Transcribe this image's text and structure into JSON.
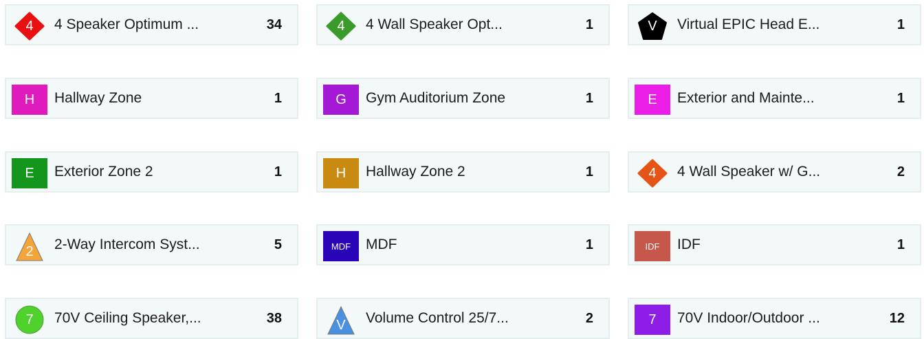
{
  "items": [
    {
      "label": "4 Speaker Optimum ...",
      "count": "34",
      "icon": {
        "name": "diamond-icon",
        "shape": "diamond",
        "color": "#e81010",
        "glyph": "4"
      }
    },
    {
      "label": "4 Wall Speaker Opt...",
      "count": "1",
      "icon": {
        "name": "diamond-icon",
        "shape": "diamond",
        "color": "#3b9b2a",
        "glyph": "4"
      }
    },
    {
      "label": "Virtual EPIC Head E...",
      "count": "1",
      "icon": {
        "name": "pentagon-icon",
        "shape": "pentagon",
        "color": "#000000",
        "glyph": "V"
      }
    },
    {
      "label": "Hallway Zone",
      "count": "1",
      "icon": {
        "name": "square-icon",
        "shape": "square",
        "color": "#e01bbd",
        "glyph": "H"
      }
    },
    {
      "label": "Gym Auditorium Zone",
      "count": "1",
      "icon": {
        "name": "square-icon",
        "shape": "square",
        "color": "#a319d6",
        "glyph": "G"
      }
    },
    {
      "label": "Exterior and Mainte...",
      "count": "1",
      "icon": {
        "name": "square-icon",
        "shape": "square",
        "color": "#ea1ee6",
        "glyph": "E"
      }
    },
    {
      "label": "Exterior Zone 2",
      "count": "1",
      "icon": {
        "name": "square-icon",
        "shape": "square",
        "color": "#14951c",
        "glyph": "E"
      }
    },
    {
      "label": "Hallway Zone 2",
      "count": "1",
      "icon": {
        "name": "square-icon",
        "shape": "square",
        "color": "#c98a12",
        "glyph": "H"
      }
    },
    {
      "label": "4 Wall Speaker w/ G...",
      "count": "2",
      "icon": {
        "name": "diamond-icon",
        "shape": "diamond",
        "color": "#e35416",
        "glyph": "4"
      }
    },
    {
      "label": "2-Way Intercom Syst...",
      "count": "5",
      "icon": {
        "name": "triangle-icon",
        "shape": "triangle",
        "color": "#f5a43a",
        "glyph": "2"
      }
    },
    {
      "label": "MDF",
      "count": "1",
      "icon": {
        "name": "square-icon",
        "shape": "square",
        "color": "#2a05b8",
        "glyph": "MDF"
      }
    },
    {
      "label": "IDF",
      "count": "1",
      "icon": {
        "name": "square-icon",
        "shape": "square",
        "color": "#c5574b",
        "glyph": "IDF"
      }
    },
    {
      "label": "70V Ceiling Speaker,...",
      "count": "38",
      "icon": {
        "name": "circle-icon",
        "shape": "circle",
        "color": "#4fd32c",
        "glyph": "7"
      }
    },
    {
      "label": "Volume Control 25/7...",
      "count": "2",
      "icon": {
        "name": "triangle-icon",
        "shape": "triangle",
        "color": "#4a8fe0",
        "glyph": "V"
      }
    },
    {
      "label": "70V Indoor/Outdoor ...",
      "count": "12",
      "icon": {
        "name": "square-icon",
        "shape": "square",
        "color": "#8f1de8",
        "glyph": "7"
      }
    }
  ]
}
